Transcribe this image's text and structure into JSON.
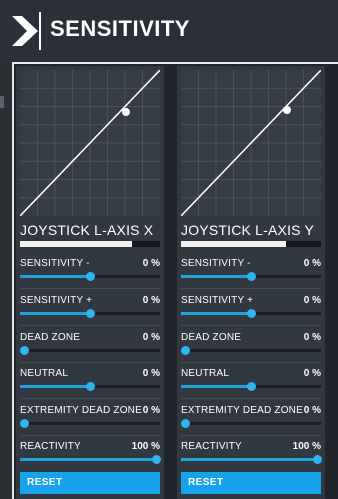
{
  "header": {
    "title": "SENSITIVITY"
  },
  "panels": [
    {
      "axis_name": "JOYSTICK L-AXIS X",
      "axis_position": 0.8,
      "curve": {
        "linear": true,
        "point": [
          0.72,
          0.72
        ]
      },
      "settings": [
        {
          "label": "SENSITIVITY -",
          "value": "0 %",
          "level": 0.5
        },
        {
          "label": "SENSITIVITY +",
          "value": "0 %",
          "level": 0.5
        },
        {
          "label": "DEAD ZONE",
          "value": "0 %",
          "level": 0.0
        },
        {
          "label": "NEUTRAL",
          "value": "0 %",
          "level": 0.5
        },
        {
          "label": "EXTREMITY DEAD ZONE",
          "value": "0 %",
          "level": 0.0
        },
        {
          "label": "REACTIVITY",
          "value": "100 %",
          "level": 1.0
        }
      ],
      "reset_label": "RESET"
    },
    {
      "axis_name": "JOYSTICK L-AXIS Y",
      "axis_position": 0.75,
      "curve": {
        "linear": true,
        "point": [
          0.74,
          0.72
        ]
      },
      "settings": [
        {
          "label": "SENSITIVITY -",
          "value": "0 %",
          "level": 0.5
        },
        {
          "label": "SENSITIVITY +",
          "value": "0 %",
          "level": 0.5
        },
        {
          "label": "DEAD ZONE",
          "value": "0 %",
          "level": 0.0
        },
        {
          "label": "NEUTRAL",
          "value": "0 %",
          "level": 0.5
        },
        {
          "label": "EXTREMITY DEAD ZONE",
          "value": "0 %",
          "level": 0.0
        },
        {
          "label": "REACTIVITY",
          "value": "100 %",
          "level": 1.0
        }
      ],
      "reset_label": "RESET"
    }
  ],
  "colors": {
    "accent": "#1fa3dc",
    "panel": "#323840",
    "background": "#2a2f36"
  },
  "icons": {
    "back": "chevron-right-icon"
  }
}
